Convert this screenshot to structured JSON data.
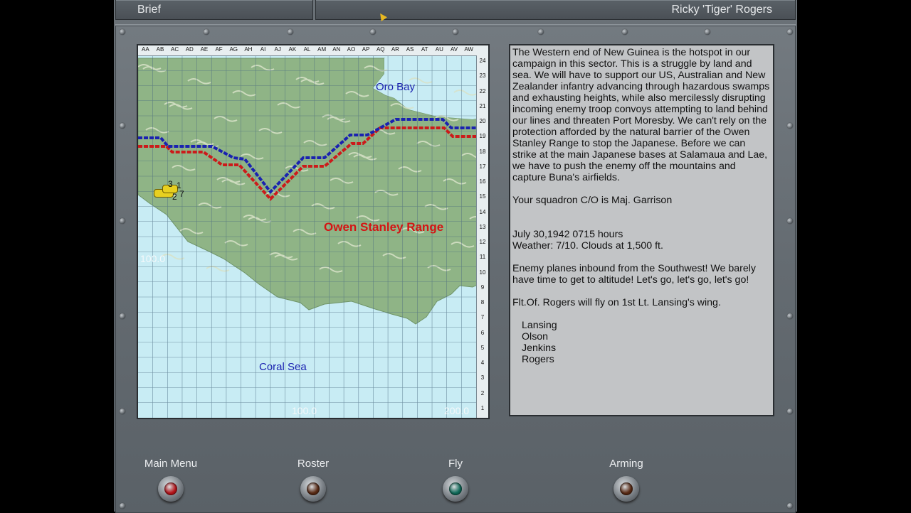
{
  "header": {
    "title": "Brief",
    "pilot": "Ricky 'Tiger' Rogers"
  },
  "map": {
    "column_labels": [
      "AA",
      "AB",
      "AC",
      "AD",
      "AE",
      "AF",
      "AG",
      "AH",
      "AI",
      "AJ",
      "AK",
      "AL",
      "AM",
      "AN",
      "AO",
      "AP",
      "AQ",
      "AR",
      "AS",
      "AT",
      "AU",
      "AV",
      "AW"
    ],
    "row_labels": [
      "24",
      "23",
      "22",
      "21",
      "20",
      "19",
      "18",
      "17",
      "16",
      "15",
      "14",
      "13",
      "12",
      "11",
      "10",
      "9",
      "8",
      "7",
      "6",
      "5",
      "4",
      "3",
      "2",
      "1"
    ],
    "place_labels": {
      "oro_bay": "Oro Bay",
      "owen_stanley": "Owen Stanley Range",
      "coral_sea": "Coral Sea"
    },
    "scale_labels": {
      "left": "100.0",
      "bottom_mid": "100.0",
      "bottom_right": "200.0"
    },
    "flight_marker_numbers": [
      "3",
      "1",
      "2",
      "7"
    ],
    "colors": {
      "sea": "#c8ecf4",
      "land": "#8fb486",
      "friendly_front": "#1a22b0",
      "enemy_front": "#cc1a1a"
    }
  },
  "brief": {
    "paragraph1": "The Western end of New Guinea is the hotspot in our campaign in this sector. This is a struggle by land and sea. We will have to support our US, Australian and New Zealander infantry advancing through hazardous swamps and exhausting heights, while also mercilessly disrupting incoming enemy troop convoys attempting to land behind our lines and threaten Port Moresby. We can't rely on the protection afforded by the natural barrier of the Owen Stanley Range to stop the Japanese. Before we can strike at the main Japanese bases at Salamaua and Lae, we have to push the enemy off the mountains and capture Buna's airfields.",
    "commander": "Your squadron C/O is Maj. Garrison",
    "datetime": "July 30,1942 0715 hours",
    "weather": "Weather: 7/10. Clouds at 1,500 ft.",
    "situation": "Enemy planes inbound from the Southwest! We barely have time to get to altitude! Let's go, let's go, let's go!",
    "assignment": "Flt.Of. Rogers will fly on 1st Lt. Lansing's wing.",
    "flight": [
      "Lansing",
      "Olson",
      "Jenkins",
      "Rogers"
    ]
  },
  "buttons": [
    {
      "label": "Main Menu",
      "light": "#b8141a"
    },
    {
      "label": "Roster",
      "light": "#5a2a14"
    },
    {
      "label": "Fly",
      "light": "#0f6b5a"
    },
    {
      "label": "Arming",
      "light": "#5a2a14"
    }
  ]
}
